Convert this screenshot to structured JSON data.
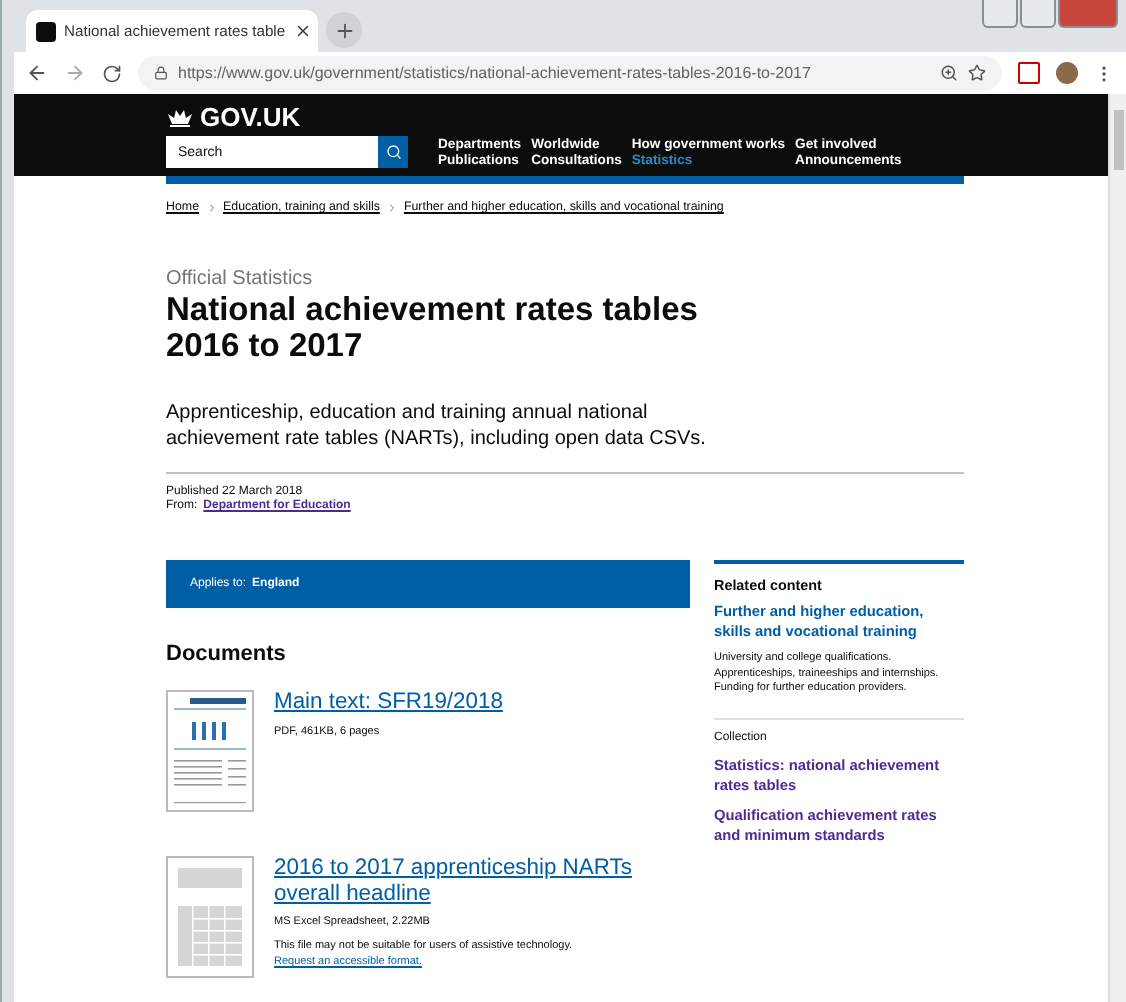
{
  "browser": {
    "tab_title": "National achievement rates table",
    "url": "https://www.gov.uk/government/statistics/national-achievement-rates-tables-2016-to-2017"
  },
  "header": {
    "logo": "GOV.UK",
    "search_placeholder": "Search",
    "nav": [
      {
        "label": "Departments",
        "selected": false
      },
      {
        "label": "Worldwide",
        "selected": false
      },
      {
        "label": "How government works",
        "selected": false
      },
      {
        "label": "Get involved",
        "selected": false
      },
      {
        "label": "Publications",
        "selected": false
      },
      {
        "label": "Consultations",
        "selected": false
      },
      {
        "label": "Statistics",
        "selected": true
      },
      {
        "label": "Announcements",
        "selected": false
      }
    ]
  },
  "breadcrumbs": [
    "Home",
    "Education, training and skills",
    "Further and higher education, skills and vocational training"
  ],
  "page": {
    "kicker": "Official Statistics",
    "title": "National achievement rates tables 2016 to 2017",
    "description": "Apprenticeship, education and training annual national achievement rate tables (NARTs), including open data CSVs.",
    "published": "Published 22 March 2018",
    "from_label": "From:",
    "from_link": "Department for Education"
  },
  "applies": {
    "label": "Applies to:",
    "value": "England"
  },
  "documents": {
    "heading": "Documents",
    "items": [
      {
        "kind": "pdf",
        "title": "Main text: SFR19/2018",
        "meta": "PDF, 461KB, 6 pages"
      },
      {
        "kind": "spreadsheet",
        "title": "2016 to 2017 apprenticeship NARTs overall headline",
        "meta": "MS Excel Spreadsheet, 2.22MB",
        "note": "This file may not be suitable for users of assistive technology.",
        "note_link": "Request an accessible format."
      }
    ]
  },
  "related": {
    "heading": "Related content",
    "topic": "Further and higher education, skills and vocational training",
    "topic_description": "University and college qualifications. Apprenticeships, traineeships and internships. Funding for further education providers.",
    "collection_label": "Collection",
    "collections": [
      "Statistics: national achievement rates tables",
      "Qualification achievement rates and minimum standards"
    ]
  }
}
